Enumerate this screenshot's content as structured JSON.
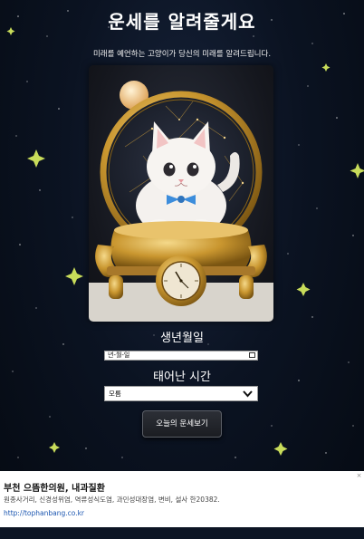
{
  "header": {
    "title": "운세를 알려줄게요",
    "subtitle": "미래를 예언하는 고양이가 당신의 미래를 알려드립니다."
  },
  "hero": {
    "image_subject": "white kitten with blue bow sitting in golden astrolabe frame"
  },
  "form": {
    "birthdate_label": "생년월일",
    "birthdate_placeholder": "년-월-일",
    "birthtime_label": "태어난 시간",
    "birthtime_selected": "모름",
    "submit_label": "오늘의 운세보기"
  },
  "ad": {
    "title": "부천 으뜸한의원, 내과질환",
    "description": "원종사거리, 신경성위염, 역류성식도염, 과민성대장염, 변비, 설사 한20382.",
    "url": "http://tophanbang.co.kr",
    "close_symbol": "×"
  },
  "colors": {
    "background": "#0b1322",
    "star": "#c8dc5a",
    "gold": "#c9962f",
    "link": "#1a55b0"
  }
}
